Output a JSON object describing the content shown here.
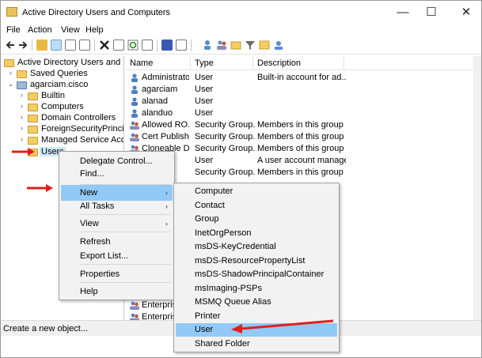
{
  "window": {
    "title": "Active Directory Users and Computers",
    "controls": [
      "—",
      "☐",
      "✕"
    ]
  },
  "menubar": [
    "File",
    "Action",
    "View",
    "Help"
  ],
  "tree": {
    "items": [
      {
        "label": "Active Directory Users and Com",
        "twisty": ""
      },
      {
        "label": "Saved Queries",
        "twisty": "›"
      },
      {
        "label": "agarciam.cisco",
        "twisty": "⌄"
      },
      {
        "label": "Builtin",
        "twisty": "›"
      },
      {
        "label": "Computers",
        "twisty": "›"
      },
      {
        "label": "Domain Controllers",
        "twisty": "›"
      },
      {
        "label": "ForeignSecurityPrincipal",
        "twisty": "›"
      },
      {
        "label": "Managed Service Accour",
        "twisty": "›"
      },
      {
        "label": "Users",
        "twisty": ""
      }
    ]
  },
  "list": {
    "columns": [
      "Name",
      "Type",
      "Description"
    ],
    "rows": [
      {
        "name": "Administrator",
        "type": "User",
        "desc": "Built-in account for ad...",
        "icon": "user"
      },
      {
        "name": "agarciam",
        "type": "User",
        "desc": "",
        "icon": "user"
      },
      {
        "name": "alanad",
        "type": "User",
        "desc": "",
        "icon": "user"
      },
      {
        "name": "alanduo",
        "type": "User",
        "desc": "",
        "icon": "user"
      },
      {
        "name": "Allowed RO...",
        "type": "Security Group...",
        "desc": "Members in this group c...",
        "icon": "group"
      },
      {
        "name": "Cert Publish...",
        "type": "Security Group...",
        "desc": "Members of this group ...",
        "icon": "group"
      },
      {
        "name": "Cloneable D...",
        "type": "Security Group...",
        "desc": "Members of this group t...",
        "icon": "group"
      },
      {
        "name": "",
        "type": "User",
        "desc": "A user account manage...",
        "icon": "user"
      },
      {
        "name": "",
        "type": "Security Group...",
        "desc": "Members in this group c...",
        "icon": "group"
      },
      {
        "name": "Enterprise",
        "type": "",
        "desc": "",
        "icon": "group"
      },
      {
        "name": "Enterprise",
        "type": "",
        "desc": "",
        "icon": "group"
      }
    ]
  },
  "context_menu": {
    "items": [
      {
        "label": "Delegate Control...",
        "arrow": ""
      },
      {
        "label": "Find...",
        "arrow": ""
      },
      {
        "label": "New",
        "arrow": "›"
      },
      {
        "label": "All Tasks",
        "arrow": "›"
      },
      {
        "label": "View",
        "arrow": "›"
      },
      {
        "label": "Refresh",
        "arrow": ""
      },
      {
        "label": "Export List...",
        "arrow": ""
      },
      {
        "label": "Properties",
        "arrow": ""
      },
      {
        "label": "Help",
        "arrow": ""
      }
    ]
  },
  "submenu": {
    "items": [
      "Computer",
      "Contact",
      "Group",
      "InetOrgPerson",
      "msDS-KeyCredential",
      "msDS-ResourcePropertyList",
      "msDS-ShadowPrincipalContainer",
      "msImaging-PSPs",
      "MSMQ Queue Alias",
      "Printer",
      "User",
      "Shared Folder"
    ]
  },
  "status": "Create a new object...",
  "colors": {
    "highlight": "#91c9f7",
    "arrow": "#e0201b",
    "folder": "#f3cd62"
  }
}
